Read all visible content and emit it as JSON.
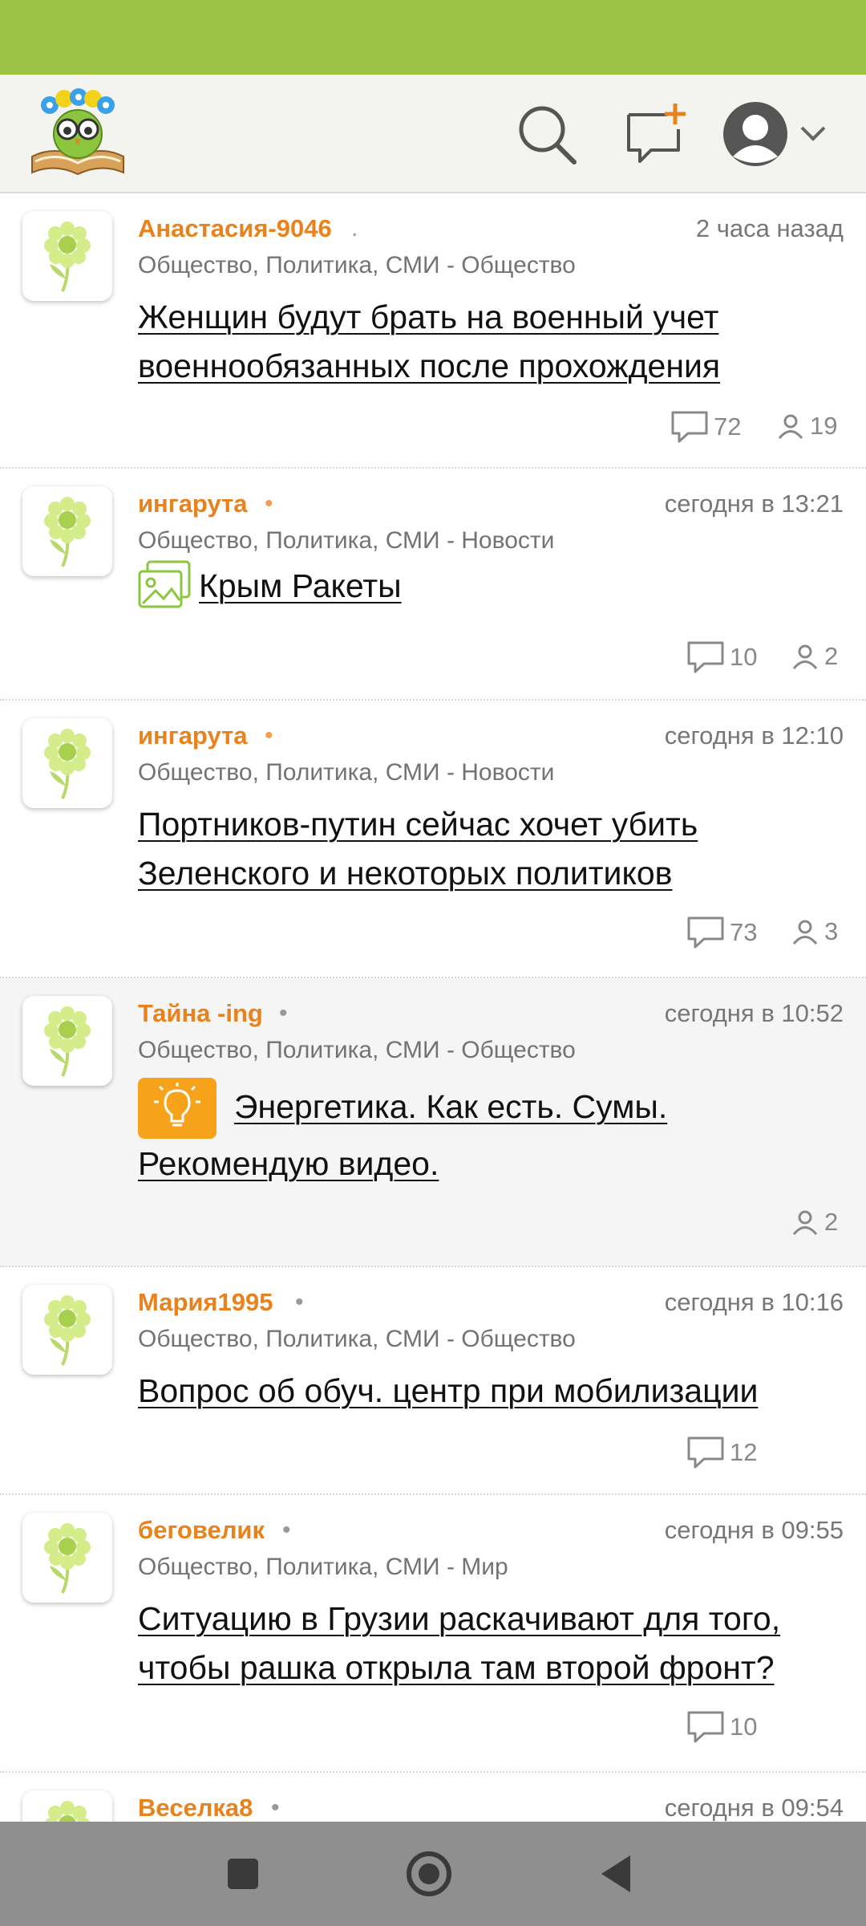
{
  "colors": {
    "status_bar": "#9cc145",
    "author": "#e8821c",
    "nav_bar": "#8f8f8f"
  },
  "header": {
    "logo_icon": "owl-on-book-logo",
    "search_icon": "search-icon",
    "new_topic_icon": "new-message-icon",
    "profile_icon": "profile-avatar-icon"
  },
  "posts": [
    {
      "author": "Анастасия-9046",
      "time": "2 часа назад",
      "category": "Общество, Политика, СМИ - Общество",
      "title_lines": [
        "Женщин будут брать на военный учет",
        "военнообязанных после прохождения"
      ],
      "comments": "72",
      "participants": "19"
    },
    {
      "author": "ингарута",
      "time": "сегодня в 13:21",
      "category": "Общество, Политика, СМИ - Новости",
      "title_lines": [
        "Крым Ракеты"
      ],
      "comments": "10",
      "participants": "2"
    },
    {
      "author": "ингарута",
      "time": "сегодня в 12:10",
      "category": "Общество, Политика, СМИ - Новости",
      "title_lines": [
        "Портников-путин сейчас хочет убить",
        "Зеленского и некоторых политиков"
      ],
      "comments": "73",
      "participants": "3"
    },
    {
      "author": "Тайна -ing",
      "time": "сегодня в 10:52",
      "category": "Общество, Политика, СМИ - Общество",
      "title_lines": [
        "Энергетика. Как есть. Сумы.",
        "Рекомендую видео."
      ],
      "participants": "2"
    },
    {
      "author": "Мария1995",
      "time": "сегодня в 10:16",
      "category": "Общество, Политика, СМИ - Общество",
      "title_lines": [
        "Вопрос об обуч. центр при мобилизации"
      ],
      "comments": "12"
    },
    {
      "author": "беговелик",
      "time": "сегодня в 09:55",
      "category": "Общество, Политика, СМИ - Мир",
      "title_lines": [
        "Ситуацию в Грузии раскачивают для того,",
        "чтобы рашка открыла там второй фронт?"
      ],
      "comments": "10"
    },
    {
      "author": "Веселка8",
      "time": "сегодня в 09:54"
    }
  ],
  "nav": {
    "recents_icon": "square-icon",
    "home_icon": "circle-icon",
    "back_icon": "triangle-back-icon"
  }
}
